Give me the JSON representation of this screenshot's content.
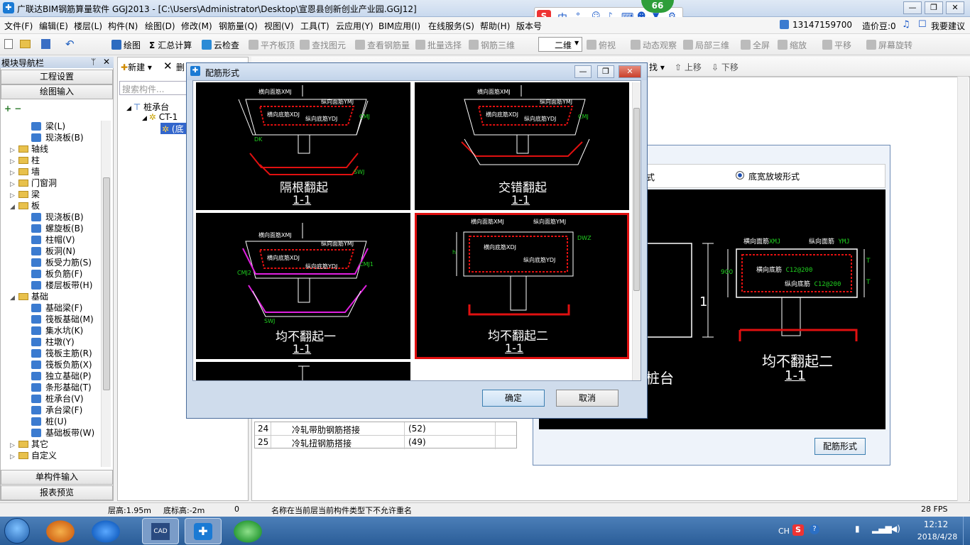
{
  "window": {
    "title": "广联达BIM钢筋算量软件 GGJ2013 - [C:\\Users\\Administrator\\Desktop\\宣恩县创新创业产业园.GGJ12]",
    "controls": [
      "—",
      "❐",
      "✕"
    ]
  },
  "menu": [
    "文件(F)",
    "编辑(E)",
    "楼层(L)",
    "构件(N)",
    "绘图(D)",
    "修改(M)",
    "钢筋量(Q)",
    "视图(V)",
    "工具(T)",
    "云应用(Y)",
    "BIM应用(I)",
    "在线服务(S)",
    "帮助(H)",
    "版本号"
  ],
  "menu_right": {
    "phone": "13147159700",
    "zaojia": "造价豆:0",
    "suggest": "我要建议"
  },
  "float_toolbar": {
    "input_mode": "中",
    "badge": "66"
  },
  "toolbar": {
    "draw": "绘图",
    "sum": "汇总计算",
    "cloud_check": "云检查",
    "flat_top": "平齐板顶",
    "find_elem": "查找图元",
    "view_rebar": "查看钢筋量",
    "batch_select": "批量选择",
    "rebar_3d": "钢筋三维",
    "view_mode": "二维",
    "top_view": "俯视",
    "dyn_view": "动态观察",
    "local_3d": "局部三维",
    "fullscreen": "全屏",
    "zoom": "缩放",
    "pan": "平移",
    "rotate": "屏幕旋转"
  },
  "nav": {
    "title": "模块导航栏",
    "pin": "ᛘ",
    "close": "✕",
    "project_settings": "工程设置",
    "drawing_input": "绘图输入",
    "single_input": "单构件输入",
    "report_preview": "报表预览",
    "tree": [
      {
        "type": "leaf",
        "label": "梁(L)"
      },
      {
        "type": "leaf",
        "label": "现浇板(B)"
      },
      {
        "type": "folder",
        "label": "轴线",
        "expanded": false
      },
      {
        "type": "folder",
        "label": "柱",
        "expanded": false
      },
      {
        "type": "folder",
        "label": "墙",
        "expanded": false
      },
      {
        "type": "folder",
        "label": "门窗洞",
        "expanded": false
      },
      {
        "type": "folder",
        "label": "梁",
        "expanded": false
      },
      {
        "type": "folder",
        "label": "板",
        "expanded": true
      },
      {
        "type": "leaf",
        "label": "现浇板(B)"
      },
      {
        "type": "leaf",
        "label": "螺旋板(B)"
      },
      {
        "type": "leaf",
        "label": "柱帽(V)"
      },
      {
        "type": "leaf",
        "label": "板洞(N)"
      },
      {
        "type": "leaf",
        "label": "板受力筋(S)"
      },
      {
        "type": "leaf",
        "label": "板负筋(F)"
      },
      {
        "type": "leaf",
        "label": "楼层板带(H)"
      },
      {
        "type": "folder",
        "label": "基础",
        "expanded": true
      },
      {
        "type": "leaf",
        "label": "基础梁(F)"
      },
      {
        "type": "leaf",
        "label": "筏板基础(M)"
      },
      {
        "type": "leaf",
        "label": "集水坑(K)"
      },
      {
        "type": "leaf",
        "label": "柱墩(Y)"
      },
      {
        "type": "leaf",
        "label": "筏板主筋(R)"
      },
      {
        "type": "leaf",
        "label": "筏板负筋(X)"
      },
      {
        "type": "leaf",
        "label": "独立基础(P)"
      },
      {
        "type": "leaf",
        "label": "条形基础(T)"
      },
      {
        "type": "leaf",
        "label": "桩承台(V)"
      },
      {
        "type": "leaf",
        "label": "承台梁(F)"
      },
      {
        "type": "leaf",
        "label": "桩(U)"
      },
      {
        "type": "leaf",
        "label": "基础板带(W)"
      },
      {
        "type": "folder",
        "label": "其它",
        "expanded": false
      },
      {
        "type": "folder",
        "label": "自定义",
        "expanded": false
      }
    ]
  },
  "component_panel": {
    "new": "新建",
    "delete": "删",
    "search_placeholder": "搜索构件...",
    "tree_root": "桩承台",
    "tree_child": "CT-1",
    "tree_leaf": "(底"
  },
  "right_toolbar": {
    "find": "找",
    "up": "上移",
    "down": "下移"
  },
  "param_table": {
    "rows": [
      {
        "no": "24",
        "name": "冷轧带肋钢筋搭接",
        "value": "(52)"
      },
      {
        "no": "25",
        "name": "冷轧扭钢筋搭接",
        "value": "(49)"
      }
    ]
  },
  "bg_dialog": {
    "radio_left": "式",
    "radio_right": "底宽放坡形式",
    "big_label_left": "桩台",
    "section_one": "1",
    "title": "均不翻起二",
    "section": "1-1",
    "button": "配筋形式",
    "labels": {
      "top_h": "横向面筋",
      "top_h_code": "XMJ",
      "top_v": "纵向面筋",
      "top_v_code": "YMJ",
      "bot_h": "横向底筋",
      "bot_h_code": "C12@200",
      "bot_v": "纵向底筋",
      "bot_v_code": "C12@200",
      "dim_900": "900",
      "dim_t": "T",
      "dim_t2": "T"
    }
  },
  "dialog": {
    "title": "配筋形式",
    "ok": "确定",
    "cancel": "取消",
    "options": [
      {
        "name": "隔根翻起",
        "section": "1-1"
      },
      {
        "name": "交错翻起",
        "section": "1-1"
      },
      {
        "name": "均不翻起一",
        "section": "1-1"
      },
      {
        "name": "均不翻起二",
        "section": "1-1"
      }
    ],
    "labels": {
      "xmj": "横向面筋XMJ",
      "ymj": "纵向面筋YMJ",
      "xdj": "横向底筋XDJ",
      "ydj": "纵向底筋YDJ",
      "cmj": "CMJ",
      "cmj1": "CMJ1",
      "cmj2": "CMJ2",
      "dk": "DK",
      "swj": "SWJ",
      "h": "h",
      "dwz": "DWZ"
    }
  },
  "status": {
    "floor_height": "层高:1.95m",
    "base_height": "底标高:-2m",
    "zero": "0",
    "message": "名称在当前层当前构件类型下不允许重名",
    "fps": "28 FPS"
  },
  "taskbar": {
    "time": "12:12",
    "date": "2018/4/28",
    "lang": "CH"
  },
  "colors": {
    "accent": "#e01010",
    "green_text": "#20d020",
    "magenta": "#e020e0"
  }
}
